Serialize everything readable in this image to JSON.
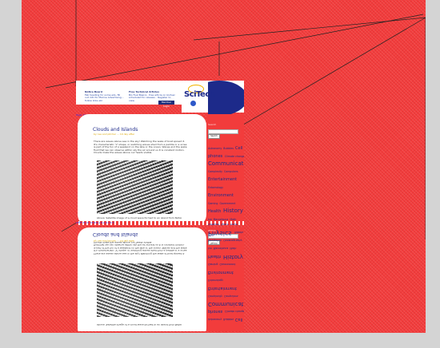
{
  "notices": {
    "left": {
      "title": "Notice Board",
      "text": "Fab heading for some ads, fill out info for Marine Advertising... follow links etc"
    },
    "right": {
      "title": "Free Technical Articles",
      "text": "Bio Fuel Basics - free article on biofuel scheduled for release... Register to view"
    },
    "members_label": "Member Login"
  },
  "logo": {
    "text": "SciTech"
  },
  "page_numbers": "Page 12 11 10 9 8 7 6 5 4 3 2 1",
  "article": {
    "title": "Clouds and Islands",
    "byline": "by: lee and pitcher ... 10 day after",
    "body": "There are waves above sea in the sky! Watching the wake of boat spread it. It's characteristic 'V' shape, or watching waves shed from a paddle or a scree is part of the fun of a weekend on the lake or the ocean. Waves and the wake fluid that we can observe within sky the air around us it is constant motion. Clouds make the waves above our heads visible.",
    "caption": "Above: Satellite image of a cloud wave formed to an island from NASA"
  },
  "sidebar": {
    "heading": "Search",
    "search_placeholder": "",
    "search_button": "Search",
    "tags": [
      {
        "label": "Astronomy",
        "size": 1
      },
      {
        "label": "Bubbles",
        "size": 1
      },
      {
        "label": "Cell",
        "size": 2
      },
      {
        "label": "phones",
        "size": 2
      },
      {
        "label": "Climate change",
        "size": 1
      },
      {
        "label": "Communication",
        "size": 3
      },
      {
        "label": "Complexity",
        "size": 1
      },
      {
        "label": "Computers",
        "size": 1
      },
      {
        "label": "Entertainment",
        "size": 2
      },
      {
        "label": "Entomology",
        "size": 1
      },
      {
        "label": "Environment",
        "size": 2
      },
      {
        "label": "Gaming",
        "size": 1
      },
      {
        "label": "Government",
        "size": 1
      },
      {
        "label": "Health",
        "size": 2
      },
      {
        "label": "History",
        "size": 3
      },
      {
        "label": "Ice",
        "size": 1
      },
      {
        "label": "Macrofauna",
        "size": 1
      },
      {
        "label": "Math",
        "size": 1
      },
      {
        "label": "Navigation",
        "size": 1
      },
      {
        "label": "Oceanography",
        "size": 1
      },
      {
        "label": "Physics",
        "size": 4
      },
      {
        "label": "Robots",
        "size": 1
      },
      {
        "label": "Software",
        "size": 1
      },
      {
        "label": "Space",
        "size": 1
      },
      {
        "label": "travel",
        "size": 1
      },
      {
        "label": "Space Time",
        "size": 1
      },
      {
        "label": "Topic",
        "size": 1
      }
    ]
  },
  "colors": {
    "background": "#f23c3c",
    "frame": "#d4d4d4",
    "logo_blue": "#1d2a8a",
    "logo_gold": "#f2b300"
  }
}
